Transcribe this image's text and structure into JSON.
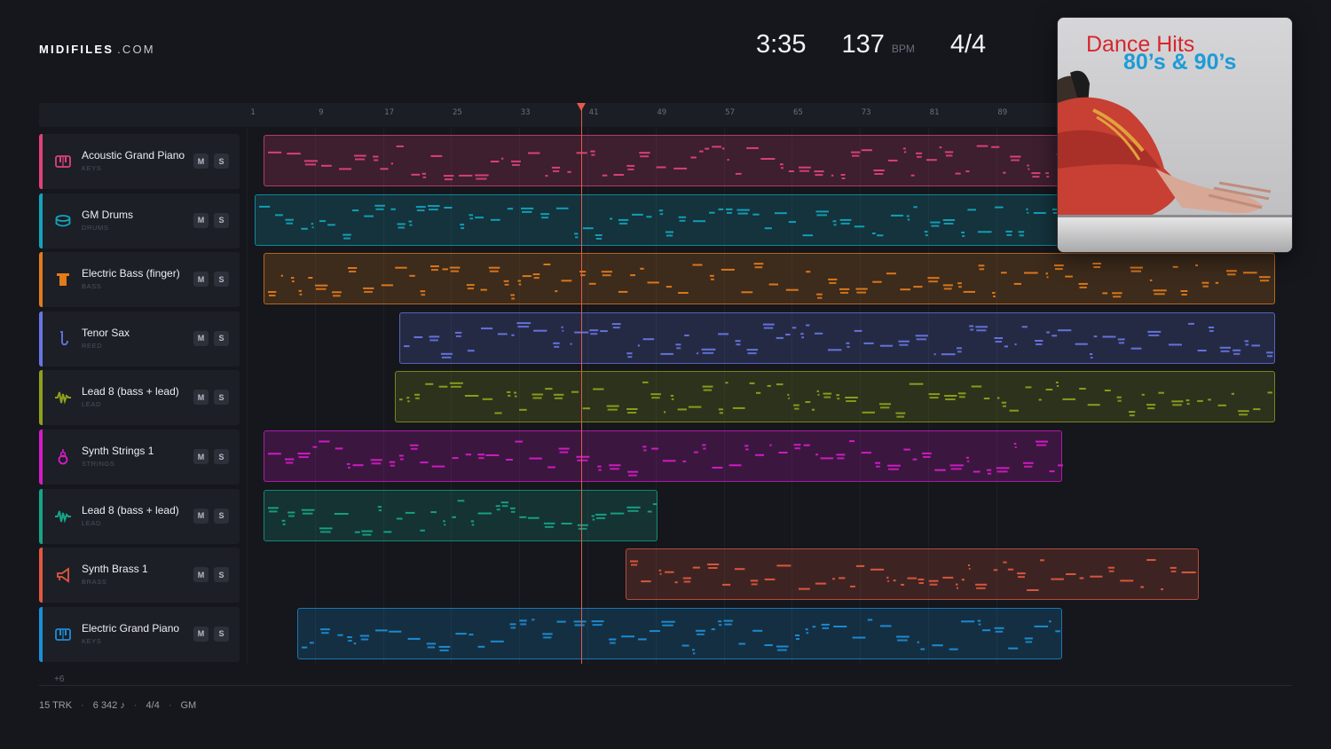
{
  "brand": {
    "name": "MIDIFILES",
    "suffix": ".COM"
  },
  "stats": {
    "duration": "3:35",
    "tempo": "137",
    "tempo_unit": "BPM",
    "time_signature": "4/4"
  },
  "album": {
    "title": "Dance Hits",
    "subtitle": "80’s & 90’s"
  },
  "ruler": {
    "bars": [
      "1",
      "9",
      "17",
      "25",
      "33",
      "41",
      "49",
      "57",
      "65",
      "73",
      "81",
      "89"
    ],
    "playhead_bar": 39.8
  },
  "tracks": [
    {
      "name": "Acoustic Grand Piano",
      "category": "KEYS",
      "color": "#e0427a",
      "icon": "piano-icon",
      "clip_start_bar": 2,
      "clip_end_bar": 121
    },
    {
      "name": "GM Drums",
      "category": "DRUMS",
      "color": "#12a4bb",
      "icon": "drum-icon",
      "clip_start_bar": 1,
      "clip_end_bar": 121
    },
    {
      "name": "Electric Bass (finger)",
      "category": "BASS",
      "color": "#e27b1a",
      "icon": "bass-icon",
      "clip_start_bar": 2,
      "clip_end_bar": 121
    },
    {
      "name": "Tenor Sax",
      "category": "REED",
      "color": "#6776e2",
      "icon": "sax-icon",
      "clip_start_bar": 18,
      "clip_end_bar": 121
    },
    {
      "name": "Lead 8 (bass + lead)",
      "category": "LEAD",
      "color": "#8fa01a",
      "icon": "wave-icon",
      "clip_start_bar": 17.5,
      "clip_end_bar": 121
    },
    {
      "name": "Synth Strings 1",
      "category": "STRINGS",
      "color": "#d61bc7",
      "icon": "strings-icon",
      "clip_start_bar": 2,
      "clip_end_bar": 96
    },
    {
      "name": "Lead 8 (bass + lead)",
      "category": "LEAD",
      "color": "#16a488",
      "icon": "wave-icon",
      "clip_start_bar": 2,
      "clip_end_bar": 48.5
    },
    {
      "name": "Synth Brass 1",
      "category": "BRASS",
      "color": "#e2583e",
      "icon": "brass-icon",
      "clip_start_bar": 44.5,
      "clip_end_bar": 112
    },
    {
      "name": "Electric Grand Piano",
      "category": "KEYS",
      "color": "#1b8fd8",
      "icon": "piano-icon",
      "clip_start_bar": 6,
      "clip_end_bar": 96
    }
  ],
  "track_buttons": {
    "mute": "M",
    "solo": "S"
  },
  "more_tracks": "+6",
  "footer": {
    "tracks": "15 TRK",
    "notes": "6 342 ♪",
    "time_signature": "4/4",
    "standard": "GM",
    "separator": "·"
  }
}
